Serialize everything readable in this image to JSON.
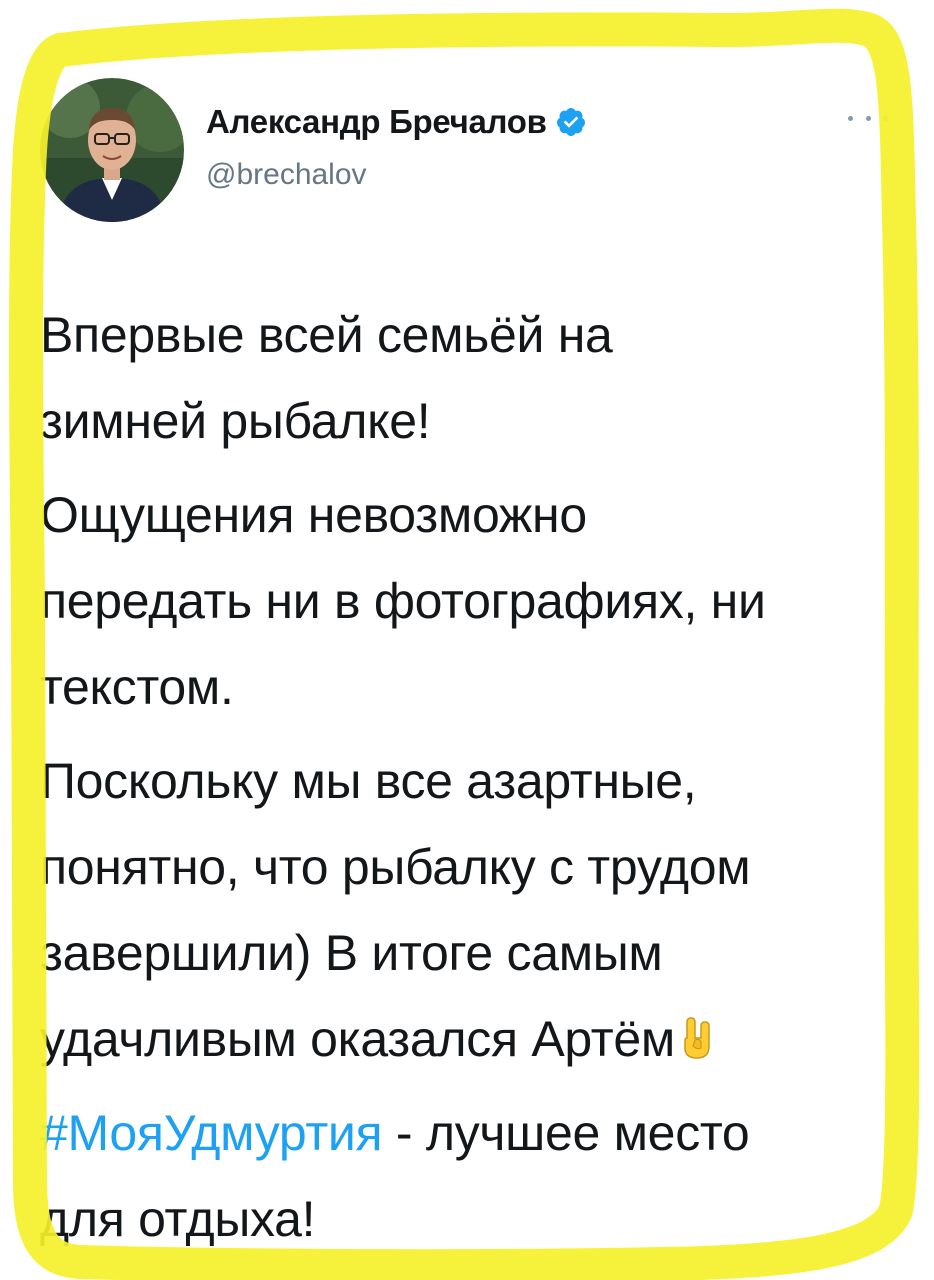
{
  "tweet": {
    "author": {
      "display_name": "Александр Бречалов",
      "handle": "@brechalov",
      "verified": true,
      "avatar_icon": "avatar-photo"
    },
    "more_icon": "more-options-icon",
    "paragraphs": [
      {
        "lines": [
          "Впервые всей семьёй на",
          "зимней рыбалке!"
        ]
      },
      {
        "lines": [
          "Ощущения невозможно",
          "передать ни в фотографиях, ни",
          "текстом."
        ]
      },
      {
        "lines": [
          "Поскольку мы все азартные,",
          "понятно, что рыбалку с трудом",
          "завершили) В итоге самым",
          "удачливым оказался Артём"
        ],
        "trailing_emoji": "🤘"
      },
      {
        "hashtag": "#МояУдмуртия",
        "after_hashtag": " - лучшее место",
        "line2": "для отдыха!"
      }
    ]
  },
  "colors": {
    "text": "#14171a",
    "secondary": "#657786",
    "link": "#1da1f2",
    "highlight": "#f5f12a",
    "verified_badge": "#1da1f2"
  }
}
